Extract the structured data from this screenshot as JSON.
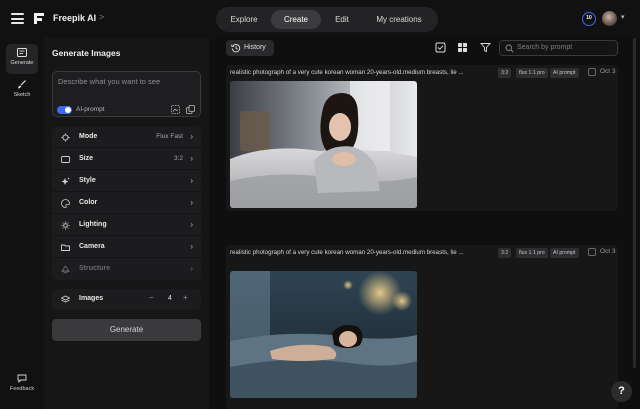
{
  "header": {
    "brand": "Freepik AI",
    "brand_chevron": ">",
    "nav": [
      {
        "label": "Explore"
      },
      {
        "label": "Create",
        "active": true
      },
      {
        "label": "Edit"
      },
      {
        "label": "My creations"
      }
    ],
    "credits": "10",
    "accent_color": "#3b6cf0"
  },
  "rail": {
    "items": [
      {
        "label": "Generate",
        "icon": "generate-icon",
        "active": true
      },
      {
        "label": "Sketch",
        "icon": "brush-icon"
      }
    ],
    "feedback": {
      "label": "Feedback",
      "icon": "chat-icon"
    }
  },
  "panel": {
    "title": "Generate Images",
    "prompt_placeholder": "Describe what you want to see",
    "ai_prompt_label": "AI-prompt",
    "ai_prompt_on": true,
    "settings": [
      {
        "label": "Mode",
        "value": "Flux Fast",
        "icon": "mode-icon"
      },
      {
        "label": "Size",
        "value": "3:2",
        "icon": "size-icon"
      },
      {
        "label": "Style",
        "value": "",
        "icon": "style-icon"
      },
      {
        "label": "Color",
        "value": "",
        "icon": "palette-icon"
      },
      {
        "label": "Lighting",
        "value": "",
        "icon": "lighting-icon"
      },
      {
        "label": "Camera",
        "value": "",
        "icon": "folder-icon"
      },
      {
        "label": "Structure",
        "value": "",
        "icon": "structure-icon",
        "disabled": true
      }
    ],
    "images_label": "Images",
    "images_count": "4",
    "minus": "−",
    "plus": "+",
    "generate_label": "Generate"
  },
  "main": {
    "history_label": "History",
    "search_placeholder": "Search by prompt",
    "cards": [
      {
        "prompt": "realistic photograph of a very cute korean woman 20-years-old.medium breasts, lie ...",
        "tags": [
          "3:2",
          "flux 1.1 pro",
          "AI prompt"
        ],
        "date": "Oct 3"
      },
      {
        "prompt": "realistic photograph of a very cute korean woman 20-years-old.medium breasts, lie ...",
        "tags": [
          "3:2",
          "flux 1.1 pro",
          "AI prompt"
        ],
        "date": "Oct 3"
      }
    ]
  },
  "help_label": "?"
}
